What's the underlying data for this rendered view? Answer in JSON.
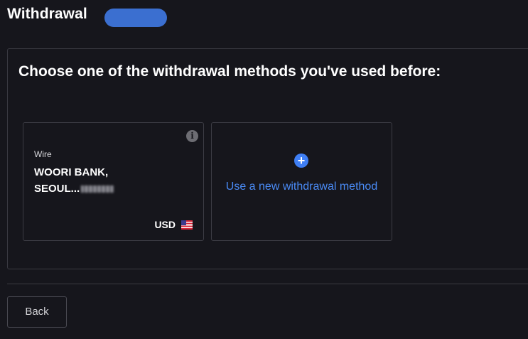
{
  "header": {
    "title": "Withdrawal"
  },
  "panel": {
    "heading": "Choose one of the withdrawal methods you've used before:"
  },
  "methods": [
    {
      "type": "Wire",
      "name_line1": "WOORI BANK,",
      "name_line2": "SEOUL...",
      "currency": "USD"
    }
  ],
  "new_method": {
    "label": "Use a new withdrawal method"
  },
  "footer": {
    "back_label": "Back"
  },
  "colors": {
    "background": "#16161c",
    "accent": "#4a8bf6",
    "badge": "#3b6fd0"
  }
}
